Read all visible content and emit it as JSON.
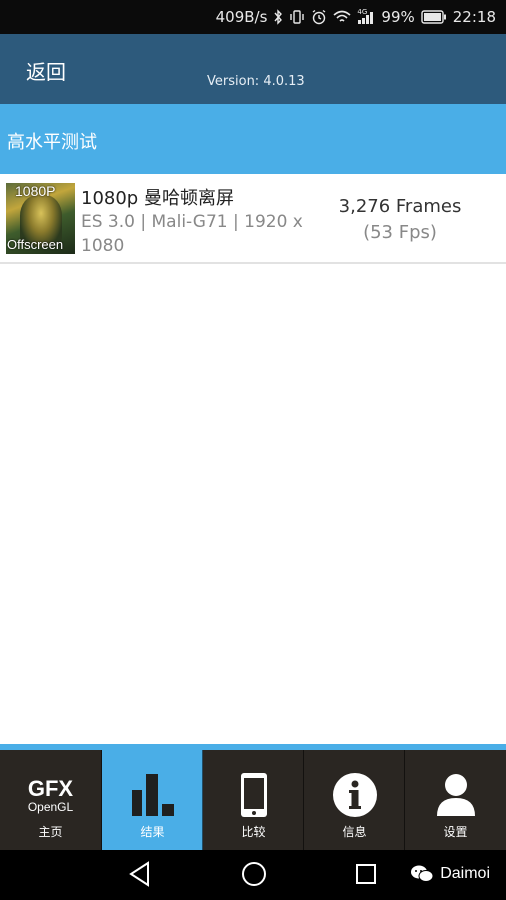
{
  "status_bar": {
    "net_speed": "409B/s",
    "battery_pct": "99%",
    "time": "22:18",
    "network_label": "4G",
    "icons": [
      "bluetooth-icon",
      "vibrate-icon",
      "alarm-icon",
      "wifi-icon",
      "signal-icon",
      "battery-icon"
    ]
  },
  "header": {
    "back_label": "返回",
    "version": "Version: 4.0.13"
  },
  "section": {
    "title": "高水平测试"
  },
  "results": [
    {
      "thumb_top": "1080P",
      "thumb_bottom": "Offscreen",
      "title": "1080p 曼哈顿离屏",
      "subtitle": "ES 3.0 | Mali-G71 | 1920 x 1080",
      "score": "3,276 Frames",
      "fps": "(53 Fps)"
    }
  ],
  "tabs": [
    {
      "label": "主页",
      "icon": "gfx-opengl-logo",
      "logo_text": "GFX",
      "logo_sub": "OpenGL",
      "active": false
    },
    {
      "label": "结果",
      "icon": "bar-chart-icon",
      "active": true
    },
    {
      "label": "比较",
      "icon": "phone-icon",
      "active": false
    },
    {
      "label": "信息",
      "icon": "info-icon",
      "active": false
    },
    {
      "label": "设置",
      "icon": "user-icon",
      "active": false
    }
  ],
  "nav_bar": {
    "watermark": "Daimoi",
    "buttons": [
      "back-triangle-icon",
      "home-circle-icon",
      "recents-square-icon"
    ]
  },
  "colors": {
    "header_bg": "#2d5a7c",
    "accent": "#4aaee7",
    "tabbar_bg": "#2a2622"
  }
}
